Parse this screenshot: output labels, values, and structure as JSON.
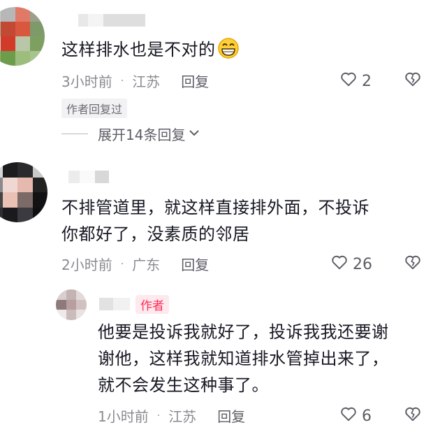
{
  "comments": [
    {
      "text": "这样排水也是不对的",
      "time": "3小时前",
      "location": "江苏",
      "reply_label": "回复",
      "likes": "2",
      "badge": "作者回复过",
      "expand_label": "展开14条回复"
    },
    {
      "text_line1": "不排管道里，就这样直接排外面，不投诉",
      "text_line2": "你都好了，没素质的邻居",
      "time": "2小时前",
      "location": "广东",
      "reply_label": "回复",
      "likes": "26"
    }
  ],
  "reply": {
    "author_tag": "作者",
    "text_line1": "他要是投诉我就好了，投诉我我还要谢",
    "text_line2": "谢他，这样我就知道排水管掉出来了，",
    "text_line3": "就不会发生这种事了。",
    "time": "1小时前",
    "location": "江苏",
    "reply_label": "回复",
    "likes": "6"
  },
  "separator": "·",
  "colors": {
    "accent": "#fe2c55",
    "meta": "#8a8b91",
    "text": "#161823"
  },
  "icons": [
    "heart-icon",
    "dislike-heart-icon",
    "grin-emoji-icon",
    "chevron-down-icon"
  ]
}
